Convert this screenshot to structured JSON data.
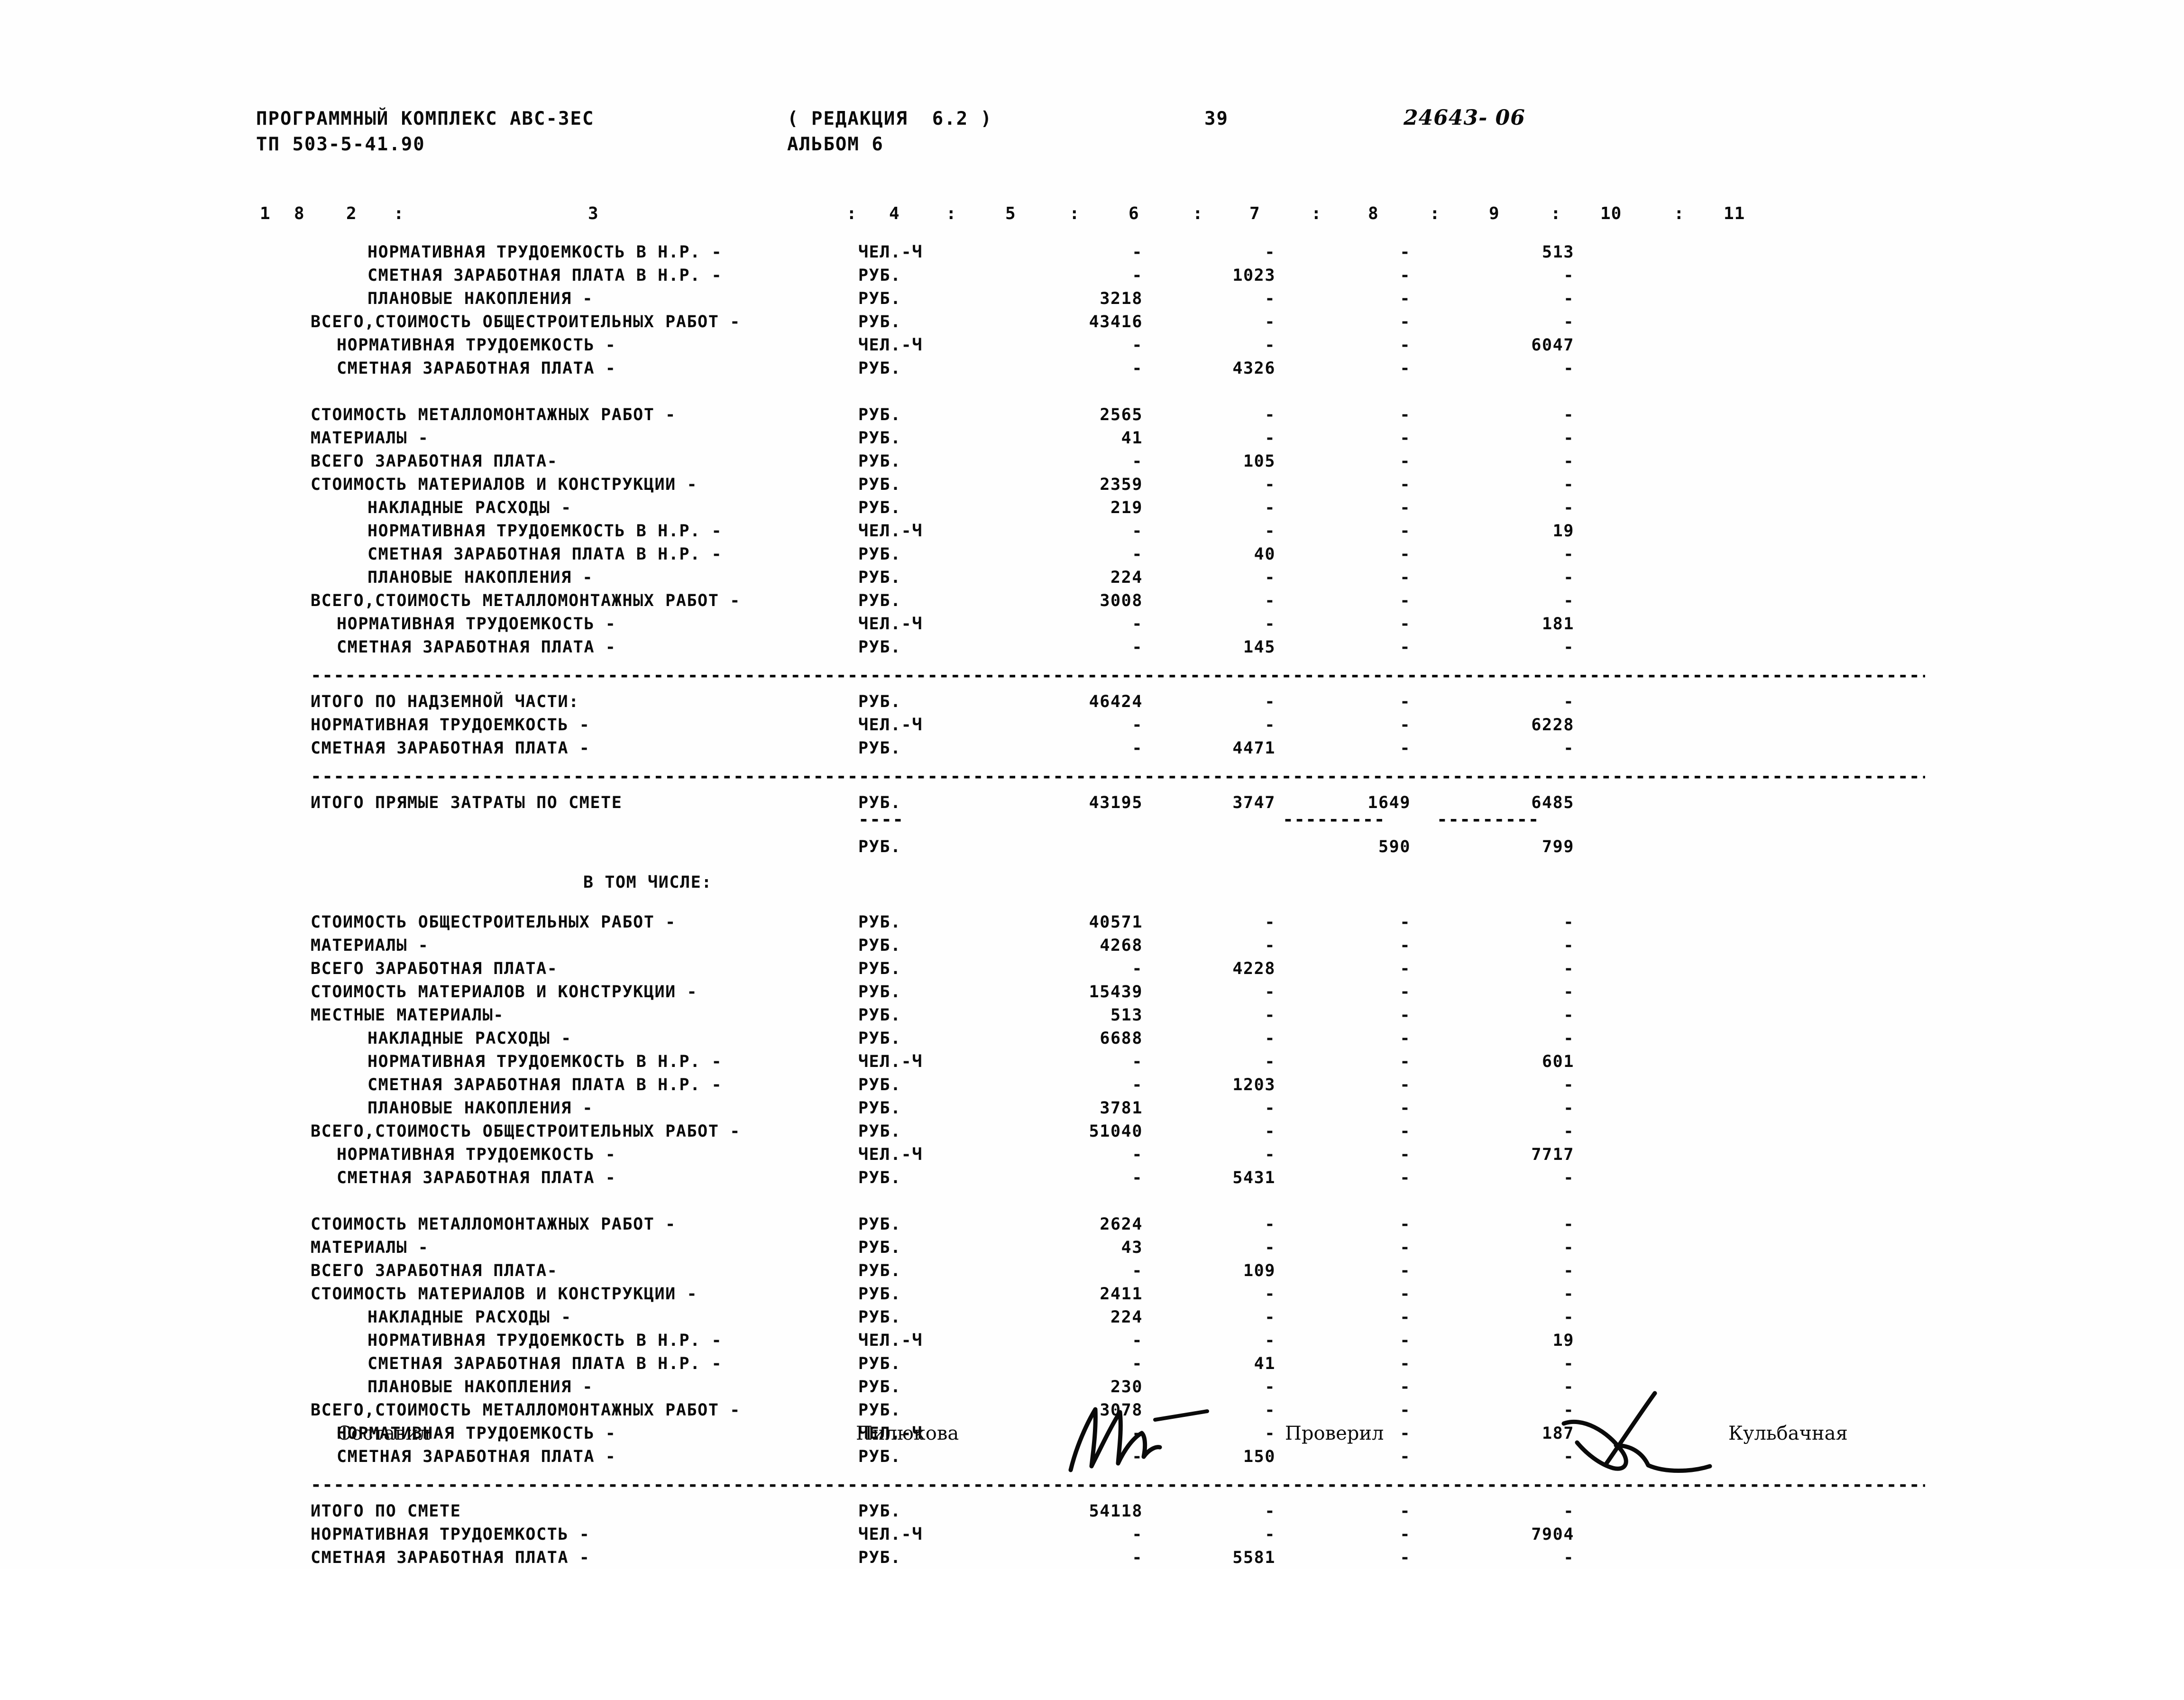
{
  "header": {
    "program_line": "ПРОГРАММНЫЙ КОМПЛЕКС АВС-3ЕС",
    "revision": "( РЕДАКЦИЯ  6.2 )",
    "page_number": "39",
    "doc_code": "24643- 06",
    "tp_line": "ТП 503-5-41.90",
    "album": "АЛЬБОМ 6"
  },
  "column_header": {
    "c1": "1",
    "c1b": "8",
    "c2": "2",
    "sep2": ":",
    "c3": "3",
    "sep3": ":",
    "c4": "4",
    "sep4": ":",
    "c5": "5",
    "sep5": ":",
    "c6": "6",
    "sep6": ":",
    "c7": "7",
    "sep7": ":",
    "c8": "8",
    "sep8": ":",
    "c9": "9",
    "sep9": ":",
    "c10": "10",
    "sep10": ":",
    "c11": "11"
  },
  "blocks": [
    {
      "id": "block-obschestroitelnye-nadzemnaya",
      "rows": [
        {
          "label": "НОРМАТИВНАЯ ТРУДОЕМКОСТЬ В Н.Р. -",
          "indent": "indent2",
          "unit": "ЧЕЛ.-Ч",
          "c7": "-",
          "c8": "-",
          "c9": "-",
          "c11": "513"
        },
        {
          "label": "СМЕТНАЯ ЗАРАБОТНАЯ ПЛАТА В Н.Р. -",
          "indent": "indent2",
          "unit": "РУБ.",
          "c7": "-",
          "c8": "1023",
          "c9": "-",
          "c11": "-"
        },
        {
          "label": "ПЛАНОВЫЕ НАКОПЛЕНИЯ -",
          "indent": "indent2",
          "unit": "РУБ.",
          "c7": "3218",
          "c8": "-",
          "c9": "-",
          "c11": "-"
        },
        {
          "label": "ВСЕГО,СТОИМОСТЬ ОБЩЕСТРОИТЕЛЬНЫХ РАБОТ -",
          "indent": "indent0",
          "unit": "РУБ.",
          "c7": "43416",
          "c8": "-",
          "c9": "-",
          "c11": "-"
        },
        {
          "label": "НОРМАТИВНАЯ ТРУДОЕМКОСТЬ -",
          "indent": "indent1",
          "unit": "ЧЕЛ.-Ч",
          "c7": "-",
          "c8": "-",
          "c9": "-",
          "c11": "6047"
        },
        {
          "label": "СМЕТНАЯ ЗАРАБОТНАЯ ПЛАТА -",
          "indent": "indent1",
          "unit": "РУБ.",
          "c7": "-",
          "c8": "4326",
          "c9": "-",
          "c11": "-"
        }
      ]
    },
    {
      "id": "block-metallomontazhnye-nadzemnaya",
      "rows": [
        {
          "label": "СТОИМОСТЬ МЕТАЛЛОМОНТАЖНЫХ РАБОТ -",
          "indent": "indent0",
          "unit": "РУБ.",
          "c7": "2565",
          "c8": "-",
          "c9": "-",
          "c11": "-"
        },
        {
          "label": "МАТЕРИАЛЫ -",
          "indent": "indent0",
          "unit": "РУБ.",
          "c7": "41",
          "c8": "-",
          "c9": "-",
          "c11": "-"
        },
        {
          "label": "ВСЕГО ЗАРАБОТНАЯ ПЛАТА-",
          "indent": "indent0",
          "unit": "РУБ.",
          "c7": "-",
          "c8": "105",
          "c9": "-",
          "c11": "-"
        },
        {
          "label": "СТОИМОСТЬ МАТЕРИАЛОВ И КОНСТРУКЦИИ -",
          "indent": "indent0",
          "unit": "РУБ.",
          "c7": "2359",
          "c8": "-",
          "c9": "-",
          "c11": "-"
        },
        {
          "label": "НАКЛАДНЫЕ РАСХОДЫ -",
          "indent": "indent2",
          "unit": "РУБ.",
          "c7": "219",
          "c8": "-",
          "c9": "-",
          "c11": "-"
        },
        {
          "label": "НОРМАТИВНАЯ ТРУДОЕМКОСТЬ В Н.Р. -",
          "indent": "indent2",
          "unit": "ЧЕЛ.-Ч",
          "c7": "-",
          "c8": "-",
          "c9": "-",
          "c11": "19"
        },
        {
          "label": "СМЕТНАЯ ЗАРАБОТНАЯ ПЛАТА В Н.Р. -",
          "indent": "indent2",
          "unit": "РУБ.",
          "c7": "-",
          "c8": "40",
          "c9": "-",
          "c11": "-"
        },
        {
          "label": "ПЛАНОВЫЕ НАКОПЛЕНИЯ -",
          "indent": "indent2",
          "unit": "РУБ.",
          "c7": "224",
          "c8": "-",
          "c9": "-",
          "c11": "-"
        },
        {
          "label": "ВСЕГО,СТОИМОСТЬ МЕТАЛЛОМОНТАЖНЫХ РАБОТ -",
          "indent": "indent0",
          "unit": "РУБ.",
          "c7": "3008",
          "c8": "-",
          "c9": "-",
          "c11": "-"
        },
        {
          "label": "НОРМАТИВНАЯ ТРУДОЕМКОСТЬ -",
          "indent": "indent1",
          "unit": "ЧЕЛ.-Ч",
          "c7": "-",
          "c8": "-",
          "c9": "-",
          "c11": "181"
        },
        {
          "label": "СМЕТНАЯ ЗАРАБОТНАЯ ПЛАТА -",
          "indent": "indent1",
          "unit": "РУБ.",
          "c7": "-",
          "c8": "145",
          "c9": "-",
          "c11": "-"
        }
      ]
    },
    {
      "id": "block-itogo-nadzemnaya",
      "rows": [
        {
          "label": "ИТОГО ПО НАДЗЕМНОЙ ЧАСТИ:",
          "indent": "indent0",
          "unit": "РУБ.",
          "c7": "46424",
          "c8": "-",
          "c9": "-",
          "c11": "-"
        },
        {
          "label": "НОРМАТИВНАЯ ТРУДОЕМКОСТЬ -",
          "indent": "indent0",
          "unit": "ЧЕЛ.-Ч",
          "c7": "-",
          "c8": "-",
          "c9": "-",
          "c11": "6228"
        },
        {
          "label": "СМЕТНАЯ ЗАРАБОТНАЯ ПЛАТА -",
          "indent": "indent0",
          "unit": "РУБ.",
          "c7": "-",
          "c8": "4471",
          "c9": "-",
          "c11": "-"
        }
      ]
    },
    {
      "id": "block-itogo-pryamye",
      "rows": [
        {
          "label": "ИТОГО ПРЯМЫЕ ЗАТРАТЫ ПО СМЕТЕ",
          "indent": "indent0",
          "unit": "РУБ.",
          "c7": "43195",
          "c8": "3747",
          "c9": "1649",
          "c11": "6485"
        }
      ]
    },
    {
      "id": "block-pryamye-sub",
      "rows": [
        {
          "label": "",
          "indent": "indent0",
          "unit": "РУБ.",
          "c7": "",
          "c8": "",
          "c9": "590",
          "c11": "799"
        }
      ]
    },
    {
      "id": "block-obschestroitelnye-svod",
      "rows": [
        {
          "label": "СТОИМОСТЬ ОБЩЕСТРОИТЕЛЬНЫХ РАБОТ -",
          "indent": "indent0",
          "unit": "РУБ.",
          "c7": "40571",
          "c8": "-",
          "c9": "-",
          "c11": "-"
        },
        {
          "label": "МАТЕРИАЛЫ -",
          "indent": "indent0",
          "unit": "РУБ.",
          "c7": "4268",
          "c8": "-",
          "c9": "-",
          "c11": "-"
        },
        {
          "label": "ВСЕГО ЗАРАБОТНАЯ ПЛАТА-",
          "indent": "indent0",
          "unit": "РУБ.",
          "c7": "-",
          "c8": "4228",
          "c9": "-",
          "c11": "-"
        },
        {
          "label": "СТОИМОСТЬ МАТЕРИАЛОВ И КОНСТРУКЦИИ -",
          "indent": "indent0",
          "unit": "РУБ.",
          "c7": "15439",
          "c8": "-",
          "c9": "-",
          "c11": "-"
        },
        {
          "label": "МЕСТНЫЕ МАТЕРИАЛЫ-",
          "indent": "indent0",
          "unit": "РУБ.",
          "c7": "513",
          "c8": "-",
          "c9": "-",
          "c11": "-"
        },
        {
          "label": "НАКЛАДНЫЕ РАСХОДЫ -",
          "indent": "indent2",
          "unit": "РУБ.",
          "c7": "6688",
          "c8": "-",
          "c9": "-",
          "c11": "-"
        },
        {
          "label": "НОРМАТИВНАЯ ТРУДОЕМКОСТЬ В Н.Р. -",
          "indent": "indent2",
          "unit": "ЧЕЛ.-Ч",
          "c7": "-",
          "c8": "-",
          "c9": "-",
          "c11": "601"
        },
        {
          "label": "СМЕТНАЯ ЗАРАБОТНАЯ ПЛАТА В Н.Р. -",
          "indent": "indent2",
          "unit": "РУБ.",
          "c7": "-",
          "c8": "1203",
          "c9": "-",
          "c11": "-"
        },
        {
          "label": "ПЛАНОВЫЕ НАКОПЛЕНИЯ -",
          "indent": "indent2",
          "unit": "РУБ.",
          "c7": "3781",
          "c8": "-",
          "c9": "-",
          "c11": "-"
        },
        {
          "label": "ВСЕГО,СТОИМОСТЬ ОБЩЕСТРОИТЕЛЬНЫХ РАБОТ -",
          "indent": "indent0",
          "unit": "РУБ.",
          "c7": "51040",
          "c8": "-",
          "c9": "-",
          "c11": "-"
        },
        {
          "label": "НОРМАТИВНАЯ ТРУДОЕМКОСТЬ -",
          "indent": "indent1",
          "unit": "ЧЕЛ.-Ч",
          "c7": "-",
          "c8": "-",
          "c9": "-",
          "c11": "7717"
        },
        {
          "label": "СМЕТНАЯ ЗАРАБОТНАЯ ПЛАТА -",
          "indent": "indent1",
          "unit": "РУБ.",
          "c7": "-",
          "c8": "5431",
          "c9": "-",
          "c11": "-"
        }
      ]
    },
    {
      "id": "block-metallomontazhnye-svod",
      "rows": [
        {
          "label": "СТОИМОСТЬ МЕТАЛЛОМОНТАЖНЫХ РАБОТ -",
          "indent": "indent0",
          "unit": "РУБ.",
          "c7": "2624",
          "c8": "-",
          "c9": "-",
          "c11": "-"
        },
        {
          "label": "МАТЕРИАЛЫ -",
          "indent": "indent0",
          "unit": "РУБ.",
          "c7": "43",
          "c8": "-",
          "c9": "-",
          "c11": "-"
        },
        {
          "label": "ВСЕГО ЗАРАБОТНАЯ ПЛАТА-",
          "indent": "indent0",
          "unit": "РУБ.",
          "c7": "-",
          "c8": "109",
          "c9": "-",
          "c11": "-"
        },
        {
          "label": "СТОИМОСТЬ МАТЕРИАЛОВ И КОНСТРУКЦИИ -",
          "indent": "indent0",
          "unit": "РУБ.",
          "c7": "2411",
          "c8": "-",
          "c9": "-",
          "c11": "-"
        },
        {
          "label": "НАКЛАДНЫЕ РАСХОДЫ -",
          "indent": "indent2",
          "unit": "РУБ.",
          "c7": "224",
          "c8": "-",
          "c9": "-",
          "c11": "-"
        },
        {
          "label": "НОРМАТИВНАЯ ТРУДОЕМКОСТЬ В Н.Р. -",
          "indent": "indent2",
          "unit": "ЧЕЛ.-Ч",
          "c7": "-",
          "c8": "-",
          "c9": "-",
          "c11": "19"
        },
        {
          "label": "СМЕТНАЯ ЗАРАБОТНАЯ ПЛАТА В Н.Р. -",
          "indent": "indent2",
          "unit": "РУБ.",
          "c7": "-",
          "c8": "41",
          "c9": "-",
          "c11": "-"
        },
        {
          "label": "ПЛАНОВЫЕ НАКОПЛЕНИЯ -",
          "indent": "indent2",
          "unit": "РУБ.",
          "c7": "230",
          "c8": "-",
          "c9": "-",
          "c11": "-"
        },
        {
          "label": "ВСЕГО,СТОИМОСТЬ МЕТАЛЛОМОНТАЖНЫХ РАБОТ -",
          "indent": "indent0",
          "unit": "РУБ.",
          "c7": "3078",
          "c8": "-",
          "c9": "-",
          "c11": "-"
        },
        {
          "label": "НОРМАТИВНАЯ ТРУДОЕМКОСТЬ -",
          "indent": "indent1",
          "unit": "ЧЕЛ.-Ч",
          "c7": "-",
          "c8": "-",
          "c9": "-",
          "c11": "187"
        },
        {
          "label": "СМЕТНАЯ ЗАРАБОТНАЯ ПЛАТА -",
          "indent": "indent1",
          "unit": "РУБ.",
          "c7": "-",
          "c8": "150",
          "c9": "-",
          "c11": "-"
        }
      ]
    },
    {
      "id": "block-itogo-po-smete",
      "rows": [
        {
          "label": "ИТОГО ПО СМЕТЕ",
          "indent": "indent0",
          "unit": "РУБ.",
          "c7": "54118",
          "c8": "-",
          "c9": "-",
          "c11": "-"
        },
        {
          "label": "НОРМАТИВНАЯ ТРУДОЕМКОСТЬ -",
          "indent": "indent0",
          "unit": "ЧЕЛ.-Ч",
          "c7": "-",
          "c8": "-",
          "c9": "-",
          "c11": "7904"
        },
        {
          "label": "СМЕТНАЯ ЗАРАБОТНАЯ ПЛАТА -",
          "indent": "indent0",
          "unit": "РУБ.",
          "c7": "-",
          "c8": "5581",
          "c9": "-",
          "c11": "-"
        }
      ]
    }
  ],
  "v_tom_chisle": "В ТОМ ЧИСЛЕ:",
  "signature": {
    "sostavil_label": "Составил",
    "sostavil_name": "Пилюкова",
    "proveril_label": "Проверил",
    "proveril_name": "Кульбачная"
  }
}
